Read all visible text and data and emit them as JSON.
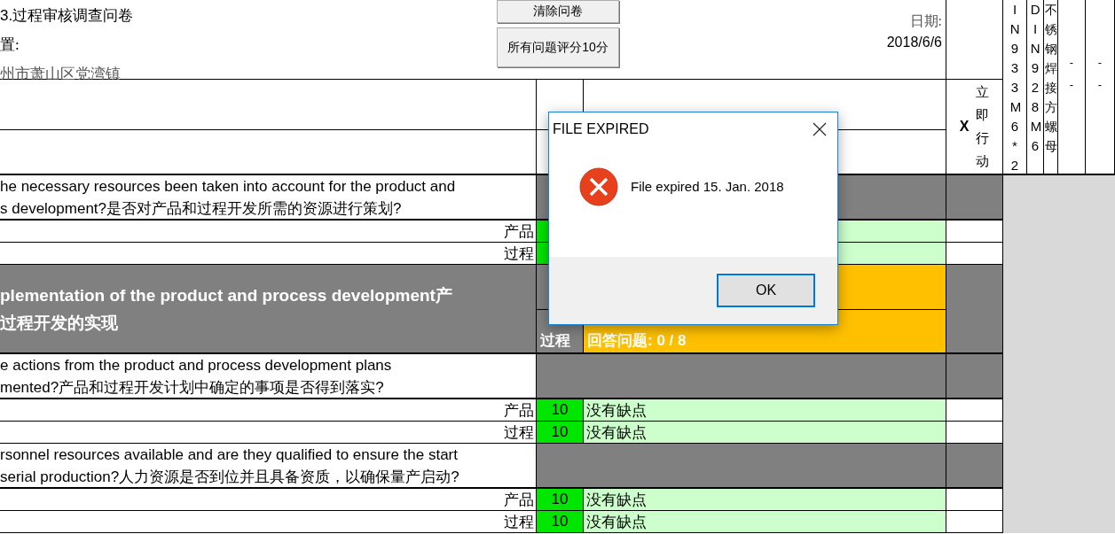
{
  "header": {
    "title": "3.过程审核调查问卷",
    "location_label": "置:",
    "location": "州市萧山区党湾镇",
    "date_label": "日期:",
    "date": "2018/6/6"
  },
  "buttons": [
    {
      "label": "清除问卷"
    },
    {
      "label": "所有问题评分10分"
    }
  ],
  "action_header": {
    "mark": "X",
    "label": "立即行动"
  },
  "part_columns": [
    {
      "kind": "vertical",
      "text": "IN933M6*2"
    },
    {
      "kind": "vertical",
      "text": "DIN928M6"
    },
    {
      "kind": "vertical",
      "text": "不锈钢焊接方螺母"
    },
    {
      "kind": "list",
      "values": [
        "-",
        "-"
      ]
    },
    {
      "kind": "list",
      "values": [
        "-",
        "-"
      ]
    }
  ],
  "rows": [
    {
      "kind": "question",
      "lines": [
        "he necessary resources been taken into account for the product and",
        "s development?是否对产品和过程开发所需的资源进行策划?"
      ]
    },
    {
      "kind": "rating",
      "label": "产品"
    },
    {
      "kind": "rating",
      "label": "过程"
    },
    {
      "kind": "section",
      "lines": [
        "plementation of the product and process development产",
        "过程开发的实现"
      ],
      "label": "过程",
      "summary": "回答问题:  0 /  8"
    },
    {
      "kind": "question",
      "lines": [
        "e actions from the product and process development plans",
        "mented?产品和过程开发计划中确定的事项是否得到落实?"
      ]
    },
    {
      "kind": "rating",
      "label": "产品",
      "score": "10",
      "comment": "没有缺点"
    },
    {
      "kind": "rating",
      "label": "过程",
      "score": "10",
      "comment": "没有缺点"
    },
    {
      "kind": "question",
      "lines": [
        "rsonnel resources available and are they qualified to ensure the start",
        "serial production?人力资源是否到位并且具备资质，以确保量产启动?"
      ]
    },
    {
      "kind": "rating",
      "label": "产品",
      "score": "10",
      "comment": "没有缺点"
    },
    {
      "kind": "rating",
      "label": "过程",
      "score": "10",
      "comment": "没有缺点"
    }
  ],
  "dialog": {
    "title": "FILE EXPIRED",
    "message": "File expired 15. Jan. 2018",
    "button": "OK"
  }
}
